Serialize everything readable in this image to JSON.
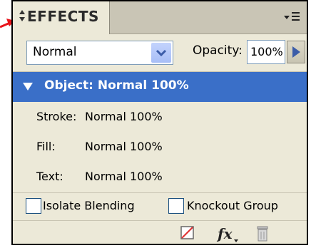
{
  "panel": {
    "title": "EFFECTS",
    "blend_mode": "Normal",
    "opacity_label": "Opacity:",
    "opacity_value": "100%"
  },
  "object_row": {
    "label": "Object: Normal 100%"
  },
  "sub_rows": [
    {
      "name": "Stroke:",
      "value": "Normal 100%"
    },
    {
      "name": "Fill:",
      "value": "Normal 100%"
    },
    {
      "name": "Text:",
      "value": "Normal 100%"
    }
  ],
  "checkboxes": {
    "isolate_label": "Isolate Blending",
    "knockout_label": "Knockout Group",
    "isolate_checked": false,
    "knockout_checked": false
  },
  "icons": {
    "clear_effects": "clear-effects-icon",
    "fx": "fx-icon",
    "trash": "trash-icon"
  },
  "colors": {
    "selection": "#3a6fc8",
    "panel_bg": "#ece9d8",
    "callout_arrow": "#e8141b"
  }
}
